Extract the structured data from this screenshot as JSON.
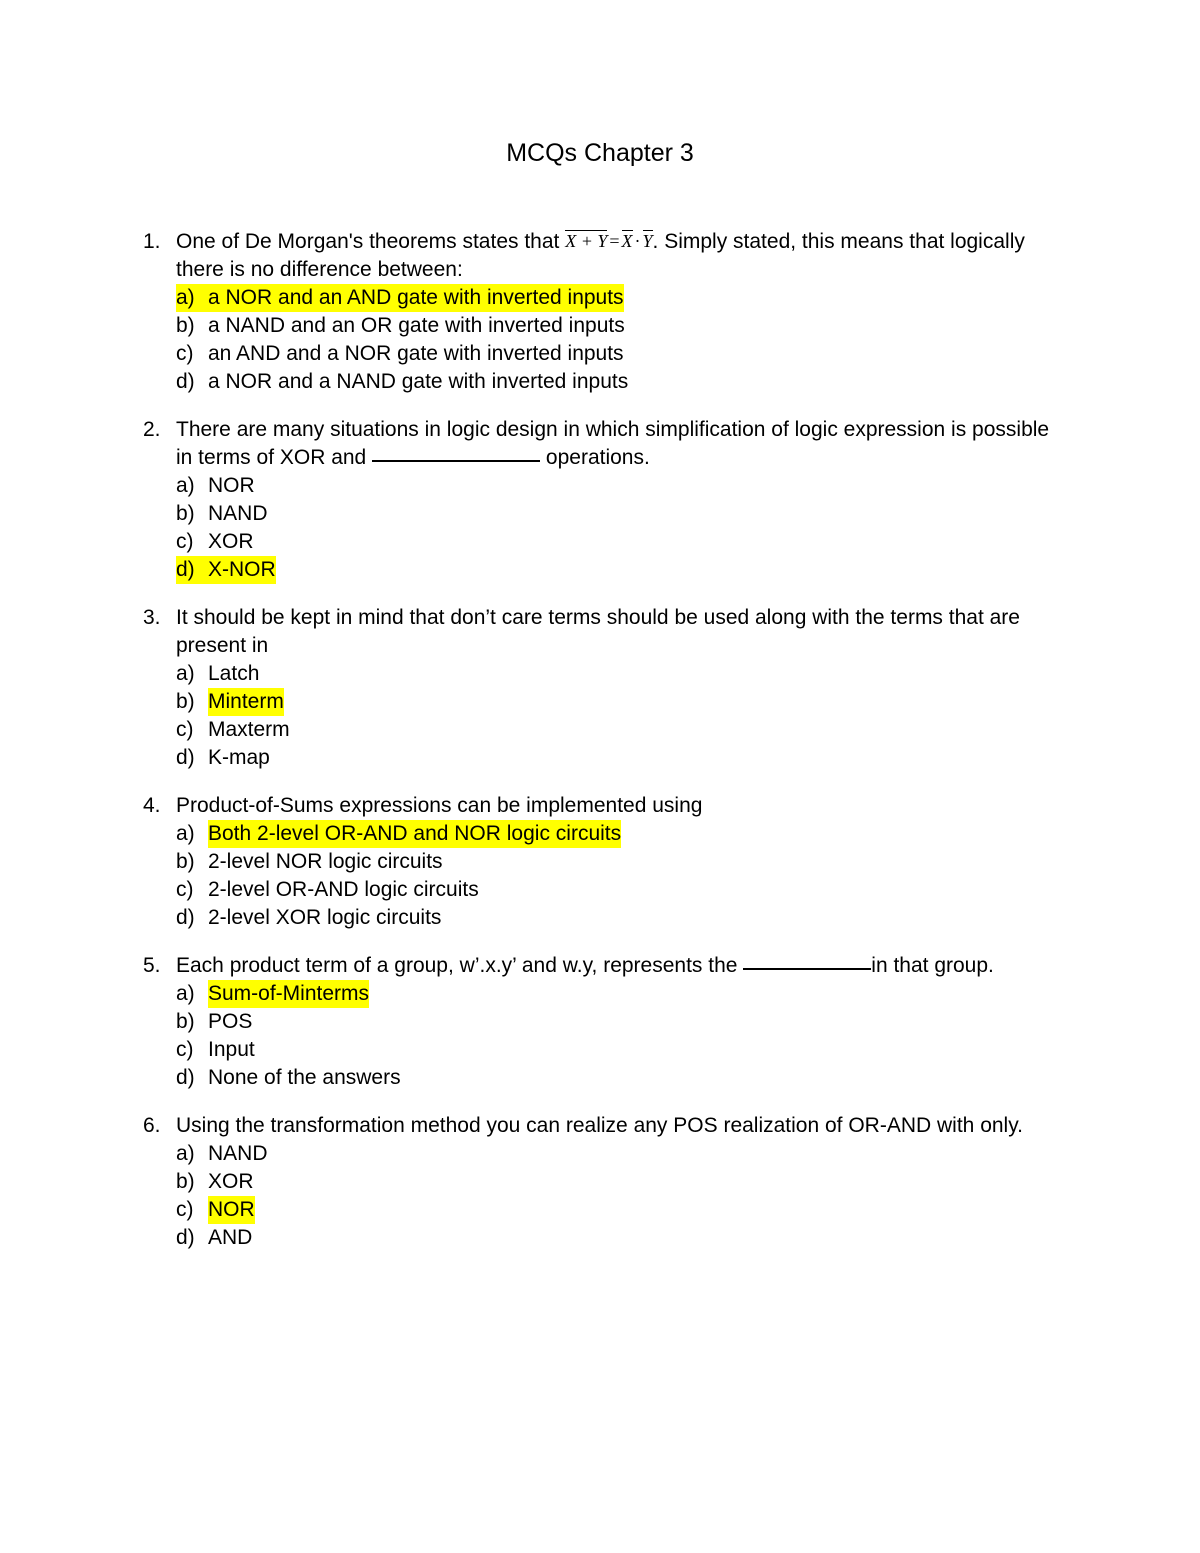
{
  "document": {
    "title": "MCQs Chapter 3",
    "highlight_color": "#ffff00",
    "text_color": "#000000",
    "background_color": "#ffffff"
  },
  "questions": [
    {
      "number": "1.",
      "text_before_formula": "One of De Morgan's theorems states that ",
      "formula": {
        "left_overbar": "X + Y",
        "equals": "=",
        "right_first": "X",
        "right_sep": "·",
        "right_second": "Y"
      },
      "text_after_formula": ". Simply stated, this means that logically there is no difference between:",
      "options": [
        {
          "letter": "a)",
          "text": "a NOR and an AND gate with inverted inputs",
          "highlighted": true
        },
        {
          "letter": "b)",
          "text": "a NAND and an OR gate with inverted inputs",
          "highlighted": false
        },
        {
          "letter": "c)",
          "text": "an AND and a NOR gate with inverted inputs",
          "highlighted": false
        },
        {
          "letter": "d)",
          "text": "a NOR and a NAND gate with inverted inputs",
          "highlighted": false
        }
      ]
    },
    {
      "number": "2.",
      "text_part1": "There are many situations in logic design in which simplification of logic expression is possible in terms of XOR and ",
      "text_part2": " operations.",
      "options": [
        {
          "letter": "a)",
          "text": "NOR",
          "highlighted": false
        },
        {
          "letter": "b)",
          "text": "NAND",
          "highlighted": false
        },
        {
          "letter": "c)",
          "text": "XOR",
          "highlighted": false
        },
        {
          "letter": "d)",
          "text": "X-NOR",
          "highlighted": true
        }
      ]
    },
    {
      "number": "3.",
      "text": "It should be kept in mind that don’t care terms should be used along with the terms that are present in",
      "options": [
        {
          "letter": "a)",
          "text": "Latch",
          "highlighted": false
        },
        {
          "letter": "b)",
          "text": "Minterm",
          "highlighted": true
        },
        {
          "letter": "c)",
          "text": "Maxterm",
          "highlighted": false
        },
        {
          "letter": "d)",
          "text": "K-map",
          "highlighted": false
        }
      ]
    },
    {
      "number": "4.",
      "text": "Product-of-Sums expressions can be implemented using",
      "options": [
        {
          "letter": "a)",
          "text": "Both 2-level OR-AND and NOR logic circuits",
          "highlighted": true
        },
        {
          "letter": "b)",
          "text": "2-level NOR logic circuits",
          "highlighted": false
        },
        {
          "letter": "c)",
          "text": "2-level OR-AND logic circuits",
          "highlighted": false
        },
        {
          "letter": "d)",
          "text": "2-level XOR logic circuits",
          "highlighted": false
        }
      ]
    },
    {
      "number": "5.",
      "text_part1": "Each product term of a group, w’.x.y’ and w.y, represents the ",
      "text_part2": "in that group.",
      "options": [
        {
          "letter": "a)",
          "text": "Sum-of-Minterms",
          "highlighted": true
        },
        {
          "letter": "b)",
          "text": "POS",
          "highlighted": false
        },
        {
          "letter": "c)",
          "text": "Input",
          "highlighted": false
        },
        {
          "letter": "d)",
          "text": "None of the answers",
          "highlighted": false
        }
      ]
    },
    {
      "number": "6.",
      "text": "Using the transformation method you can realize any POS realization of OR-AND with only.",
      "options": [
        {
          "letter": "a)",
          "text": "NAND",
          "highlighted": false
        },
        {
          "letter": "b)",
          "text": "XOR",
          "highlighted": false
        },
        {
          "letter": "c)",
          "text": "NOR",
          "highlighted": true
        },
        {
          "letter": "d)",
          "text": "AND",
          "highlighted": false
        }
      ]
    }
  ]
}
